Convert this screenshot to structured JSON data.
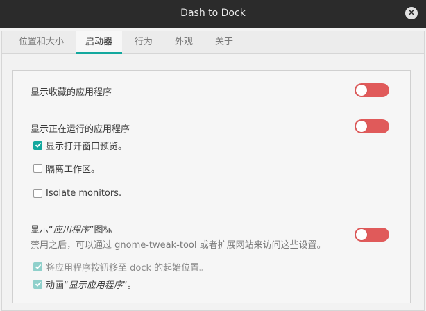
{
  "window": {
    "title": "Dash to Dock",
    "close_symbol": "×"
  },
  "tabs": [
    {
      "label": "位置和大小",
      "active": false
    },
    {
      "label": "启动器",
      "active": true
    },
    {
      "label": "行为",
      "active": false
    },
    {
      "label": "外观",
      "active": false
    },
    {
      "label": "关于",
      "active": false
    }
  ],
  "settings": {
    "show_favorites": {
      "label": "显示收藏的应用程序",
      "enabled": false
    },
    "show_running": {
      "label": "显示正在运行的应用程序",
      "enabled": false
    },
    "show_preview": {
      "label": "显示打开窗口预览。",
      "checked": true
    },
    "isolate_workspaces": {
      "label": "隔离工作区。",
      "checked": false
    },
    "isolate_monitors": {
      "label": "Isolate monitors.",
      "checked": false
    },
    "show_apps": {
      "label_prefix": "显示“",
      "label_italic": "应用程序",
      "label_suffix": "”图标",
      "description": "禁用之后，可以通过 gnome-tweak-tool 或者扩展网站来访问这些设置。",
      "enabled": false
    },
    "apps_at_top": {
      "label": "将应用程序按钮移至 dock 的起始位置。",
      "checked": true,
      "disabled": true
    },
    "animate_show_apps": {
      "label_prefix": "动画“",
      "label_italic": "显示应用程序",
      "label_suffix": "”。",
      "checked": true,
      "disabled": true
    }
  },
  "colors": {
    "accent": "#13a89e",
    "toggle_off": "#e05a5a",
    "titlebar": "#2b2b2b"
  }
}
